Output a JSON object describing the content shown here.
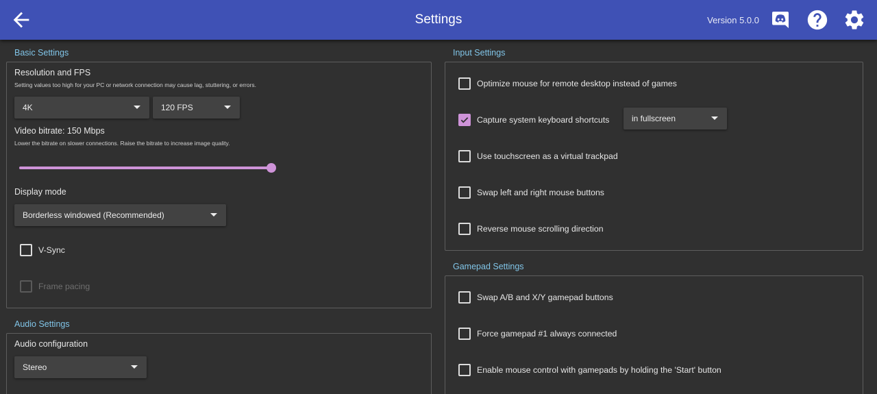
{
  "toolbar": {
    "title": "Settings",
    "version": "Version 5.0.0",
    "icons": [
      "arrow-back-icon",
      "discord-icon",
      "help-icon",
      "gear-icon"
    ]
  },
  "basic": {
    "title": "Basic Settings",
    "resolution_label": "Resolution and FPS",
    "resolution_hint": "Setting values too high for your PC or network connection may cause lag, stuttering, or errors.",
    "resolution_value": "4K",
    "fps_value": "120 FPS",
    "bitrate_label": "Video bitrate: 150 Mbps",
    "bitrate_hint": "Lower the bitrate on slower connections. Raise the bitrate to increase image quality.",
    "bitrate_slider_fraction": 1.0,
    "display_mode_label": "Display mode",
    "display_mode_value": "Borderless windowed (Recommended)",
    "vsync_label": "V-Sync",
    "vsync_checked": false,
    "frame_pacing_label": "Frame pacing",
    "frame_pacing_enabled": false
  },
  "audio": {
    "title": "Audio Settings",
    "config_label": "Audio configuration",
    "config_value": "Stereo"
  },
  "input": {
    "title": "Input Settings",
    "items": [
      {
        "label": "Optimize mouse for remote desktop instead of games",
        "checked": false
      },
      {
        "label": "Capture system keyboard shortcuts",
        "checked": true
      },
      {
        "label": "Use touchscreen as a virtual trackpad",
        "checked": false
      },
      {
        "label": "Swap left and right mouse buttons",
        "checked": false
      },
      {
        "label": "Reverse mouse scrolling direction",
        "checked": false
      }
    ],
    "capture_mode_value": "in fullscreen"
  },
  "gamepad": {
    "title": "Gamepad Settings",
    "items": [
      {
        "label": "Swap A/B and X/Y gamepad buttons",
        "checked": false
      },
      {
        "label": "Force gamepad #1 always connected",
        "checked": false
      },
      {
        "label": "Enable mouse control with gamepads by holding the 'Start' button",
        "checked": false
      }
    ]
  },
  "colors": {
    "toolbar": "#3f51b5",
    "background": "#303030",
    "accent": "#ce93d8",
    "section_title": "#81c5e8"
  }
}
